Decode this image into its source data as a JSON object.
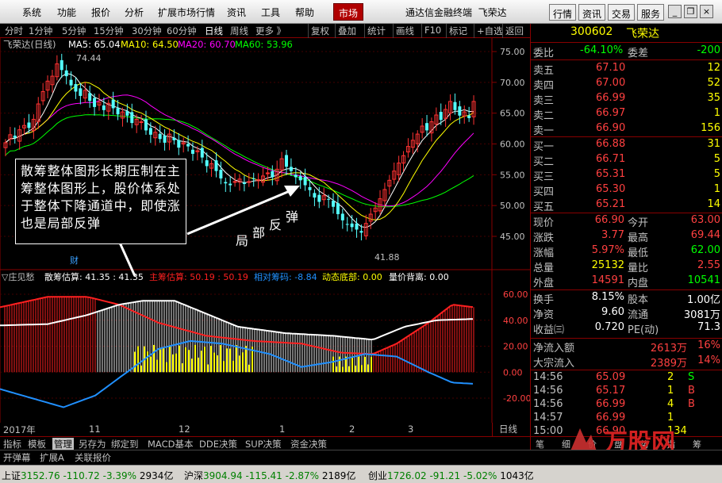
{
  "menu": {
    "items": [
      "系统",
      "功能",
      "报价",
      "分析",
      "扩展市场行情",
      "资讯",
      "工具",
      "帮助"
    ],
    "market_button": "市场",
    "app_title": "通达信金融终端",
    "stock_title": "飞荣达",
    "toolbar": [
      "行情",
      "资讯",
      "交易",
      "服务"
    ]
  },
  "period_bar": {
    "items": [
      "分时",
      "1分钟",
      "5分钟",
      "15分钟",
      "30分钟",
      "60分钟",
      "日线",
      "周线",
      "更多 》"
    ],
    "active": "日线",
    "buttons": [
      "复权",
      "叠加",
      "统计",
      "画线",
      "F10",
      "标记",
      "+自选",
      "返回"
    ]
  },
  "main_chart": {
    "legend_title": "飞荣达(日线)",
    "legend": [
      {
        "label": "MA5: 65.04",
        "color": "#ffffff"
      },
      {
        "label": "MA10: 64.50",
        "color": "#ffff00"
      },
      {
        "label": "MA20: 60.70",
        "color": "#ff00ff"
      },
      {
        "label": "MA60: 53.96",
        "color": "#00ff00"
      }
    ],
    "high_label": "74.44",
    "low_label": "41.88",
    "marker": "财",
    "y_ticks": [
      "75.00",
      "70.00",
      "65.00",
      "60.00",
      "55.00",
      "50.00",
      "45.00"
    ]
  },
  "sub_chart": {
    "legend_title": "▽庄见愁",
    "legend": [
      {
        "label": "散筹估算: 41.35 : 41.35",
        "color": "#ffffff"
      },
      {
        "label": "主筹估算: 50.19 : 50.19",
        "color": "#ff2020"
      },
      {
        "label": "相对筹码: -8.84",
        "color": "#2090ff"
      },
      {
        "label": "动态底部: 0.00",
        "color": "#ffff00"
      },
      {
        "label": "量价背离: 0.00",
        "color": "#ffffff"
      }
    ],
    "y_ticks": [
      "60.00",
      "40.00",
      "20.00",
      "0.00",
      "-20.00"
    ]
  },
  "x_axis": {
    "labels": [
      "2017年",
      "11",
      "12",
      "1",
      "2",
      "3"
    ],
    "period": "日线"
  },
  "annotation": {
    "text": "散筹整体图形长期压制在主筹整体图形上，股价体系处于整体下降通道中，即使涨也是局部反弹",
    "diag_chars": [
      "局",
      "部",
      "反",
      "弹"
    ]
  },
  "quote_panel": {
    "code": "300602",
    "name": "飞荣达",
    "weibi_label": "委比",
    "weibi": "-64.10%",
    "weicha_label": "委差",
    "weicha": "-200",
    "sell": [
      {
        "label": "卖五",
        "price": "67.10",
        "vol": "12"
      },
      {
        "label": "卖四",
        "price": "67.00",
        "vol": "52"
      },
      {
        "label": "卖三",
        "price": "66.99",
        "vol": "35"
      },
      {
        "label": "卖二",
        "price": "66.97",
        "vol": "1"
      },
      {
        "label": "卖一",
        "price": "66.90",
        "vol": "156"
      }
    ],
    "buy": [
      {
        "label": "买一",
        "price": "66.88",
        "vol": "31"
      },
      {
        "label": "买二",
        "price": "66.71",
        "vol": "5"
      },
      {
        "label": "买三",
        "price": "65.31",
        "vol": "5"
      },
      {
        "label": "买四",
        "price": "65.30",
        "vol": "1"
      },
      {
        "label": "买五",
        "price": "65.21",
        "vol": "14"
      }
    ],
    "stats": [
      {
        "l1": "现价",
        "v1": "66.90",
        "c1": "#ff4040",
        "l2": "今开",
        "v2": "63.00",
        "c2": "#ff4040"
      },
      {
        "l1": "涨跌",
        "v1": "3.77",
        "c1": "#ff4040",
        "l2": "最高",
        "v2": "69.44",
        "c2": "#ff4040"
      },
      {
        "l1": "涨幅",
        "v1": "5.97%",
        "c1": "#ff4040",
        "l2": "最低",
        "v2": "62.00",
        "c2": "#00ff00"
      },
      {
        "l1": "总量",
        "v1": "25132",
        "c1": "#ffff00",
        "l2": "量比",
        "v2": "2.55",
        "c2": "#ff4040"
      },
      {
        "l1": "外盘",
        "v1": "14591",
        "c1": "#ff4040",
        "l2": "内盘",
        "v2": "10541",
        "c2": "#00ff00"
      }
    ],
    "fin": [
      {
        "l1": "换手",
        "v1": "8.15%",
        "l2": "股本",
        "v2": "1.00亿"
      },
      {
        "l1": "净资",
        "v1": "9.60",
        "l2": "流通",
        "v2": "3081万"
      },
      {
        "l1": "收益㈢",
        "v1": "0.720",
        "l2": "PE(动)",
        "v2": "71.3"
      }
    ],
    "flow": [
      {
        "label": "净流入额",
        "value": "2613万",
        "pct": "16%"
      },
      {
        "label": "大宗流入",
        "value": "2389万",
        "pct": "14%"
      }
    ],
    "ticks": [
      {
        "time": "14:56",
        "price": "65.09",
        "vol": "2",
        "dir": "S"
      },
      {
        "time": "14:56",
        "price": "65.17",
        "vol": "1",
        "dir": "B"
      },
      {
        "time": "14:56",
        "price": "66.99",
        "vol": "4",
        "dir": "B"
      },
      {
        "time": "14:57",
        "price": "66.99",
        "vol": "1",
        "dir": ""
      },
      {
        "time": "15:00",
        "price": "66.90",
        "vol": "134",
        "dir": ""
      }
    ],
    "tail_tabs": [
      "笔",
      "细",
      "价",
      "盘",
      "势",
      "指",
      "筹"
    ]
  },
  "tabs_row1": [
    "指标",
    "模板",
    "管理",
    "另存为",
    "绑定到",
    "MACD基本",
    "DDE决策",
    "SUP决策",
    "资金决策"
  ],
  "tabs_row1_active": "管理",
  "tabs_row2": [
    "开弹幕",
    "扩展A",
    "关联报价"
  ],
  "status": {
    "sh": {
      "name": "上证",
      "price": "3152.76",
      "chg": "-110.72",
      "pct": "-3.39%",
      "amt": "2934亿"
    },
    "sz": {
      "name": "沪深",
      "price": "3904.94",
      "chg": "-115.41",
      "pct": "-2.87%",
      "amt": "2189亿"
    },
    "cy": {
      "name": "创业",
      "price": "1726.02",
      "chg": "-91.21",
      "pct": "-5.02%",
      "amt": "1043亿"
    }
  },
  "logo": {
    "text": "万股网",
    "url": "www.2010GP.com"
  }
}
